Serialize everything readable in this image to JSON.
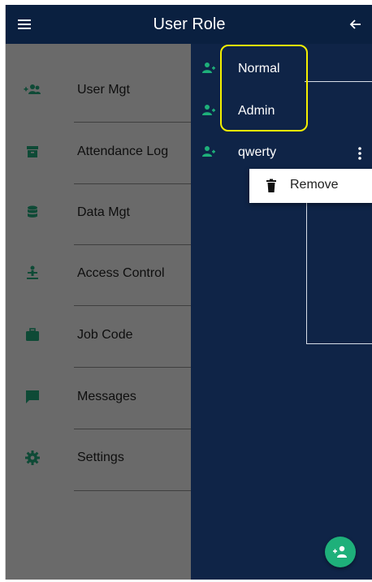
{
  "header": {
    "title": "User Role",
    "menu_icon": "hamburger-menu-icon",
    "back_icon": "arrow-left-icon"
  },
  "roles": [
    {
      "label": "Normal",
      "icon": "user-group-icon"
    },
    {
      "label": "Admin",
      "icon": "user-group-icon"
    },
    {
      "label": "qwerty",
      "icon": "user-group-icon"
    }
  ],
  "context_menu": {
    "remove_label": "Remove",
    "remove_icon": "trash-icon"
  },
  "drawer": {
    "items": [
      {
        "label": "User Mgt",
        "icon": "add-users-icon"
      },
      {
        "label": "Attendance Log",
        "icon": "archive-box-icon"
      },
      {
        "label": "Data Mgt",
        "icon": "database-icon"
      },
      {
        "label": "Access Control",
        "icon": "person-access-icon"
      },
      {
        "label": "Job Code",
        "icon": "briefcase-icon"
      },
      {
        "label": "Messages",
        "icon": "message-icon"
      },
      {
        "label": "Settings",
        "icon": "gear-icon"
      }
    ]
  },
  "fab": {
    "icon": "add-user-icon"
  },
  "colors": {
    "app_bar": "#0a2040",
    "content_bg": "#0f2447",
    "accent_green": "#1eb07a",
    "highlight_yellow": "#f5f000",
    "drawer_dimmed": "#6a6a6a"
  }
}
